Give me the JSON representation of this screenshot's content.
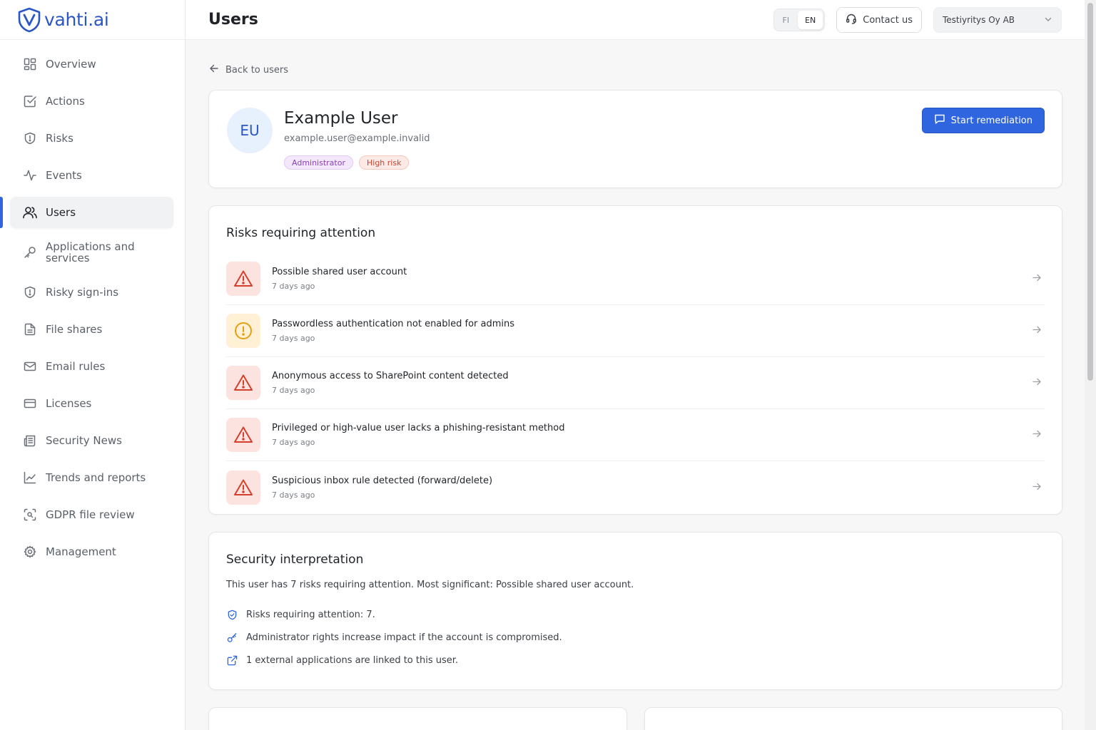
{
  "brand": {
    "name": "vahti.ai",
    "color": "#2a56c6"
  },
  "sidebar": {
    "items": [
      {
        "label": "Overview",
        "icon": "grid-icon",
        "active": false
      },
      {
        "label": "Actions",
        "icon": "check-square-icon",
        "active": false
      },
      {
        "label": "Risks",
        "icon": "shield-alert-icon",
        "active": false
      },
      {
        "label": "Events",
        "icon": "activity-icon",
        "active": false
      },
      {
        "label": "Users",
        "icon": "users-icon",
        "active": true
      },
      {
        "label": "Applications and services",
        "icon": "key-icon",
        "active": false
      },
      {
        "label": "Risky sign-ins",
        "icon": "shield-alert-icon",
        "active": false
      },
      {
        "label": "File shares",
        "icon": "file-icon",
        "active": false
      },
      {
        "label": "Email rules",
        "icon": "mail-icon",
        "active": false
      },
      {
        "label": "Licenses",
        "icon": "credit-card-icon",
        "active": false
      },
      {
        "label": "Security News",
        "icon": "newspaper-icon",
        "active": false
      },
      {
        "label": "Trends and reports",
        "icon": "chart-line-icon",
        "active": false
      },
      {
        "label": "GDPR file review",
        "icon": "scan-search-icon",
        "active": false
      },
      {
        "label": "Management",
        "icon": "gear-icon",
        "active": false
      }
    ]
  },
  "header": {
    "title": "Users",
    "lang_fi": "FI",
    "lang_en": "EN",
    "contact_label": "Contact us",
    "org_name": "Testiyritys Oy AB"
  },
  "back_label": "Back to users",
  "profile": {
    "initials": "EU",
    "name": "Example User",
    "email": "example.user@example.invalid",
    "badge_admin": "Administrator",
    "badge_risk": "High risk",
    "start_button": "Start remediation"
  },
  "risks": {
    "title": "Risks requiring attention",
    "items": [
      {
        "title": "Possible shared user account",
        "time": "7 days ago",
        "severity": "high"
      },
      {
        "title": "Passwordless authentication not enabled for admins",
        "time": "7 days ago",
        "severity": "medium"
      },
      {
        "title": "Anonymous access to SharePoint content detected",
        "time": "7 days ago",
        "severity": "high"
      },
      {
        "title": "Privileged or high-value user lacks a phishing-resistant method",
        "time": "7 days ago",
        "severity": "high"
      },
      {
        "title": "Suspicious inbox rule detected (forward/delete)",
        "time": "7 days ago",
        "severity": "high"
      }
    ]
  },
  "interpretation": {
    "title": "Security interpretation",
    "description": "This user has 7 risks requiring attention. Most significant: Possible shared user account.",
    "items": [
      {
        "text": "Risks requiring attention: 7.",
        "icon": "shield-check-icon"
      },
      {
        "text": "Administrator rights increase impact if the account is compromised.",
        "icon": "key-icon"
      },
      {
        "text": "1 external applications are linked to this user.",
        "icon": "external-link-icon"
      }
    ]
  },
  "colors": {
    "accent": "#2f66e0",
    "danger": "#d4402b",
    "warning": "#e5a012"
  }
}
